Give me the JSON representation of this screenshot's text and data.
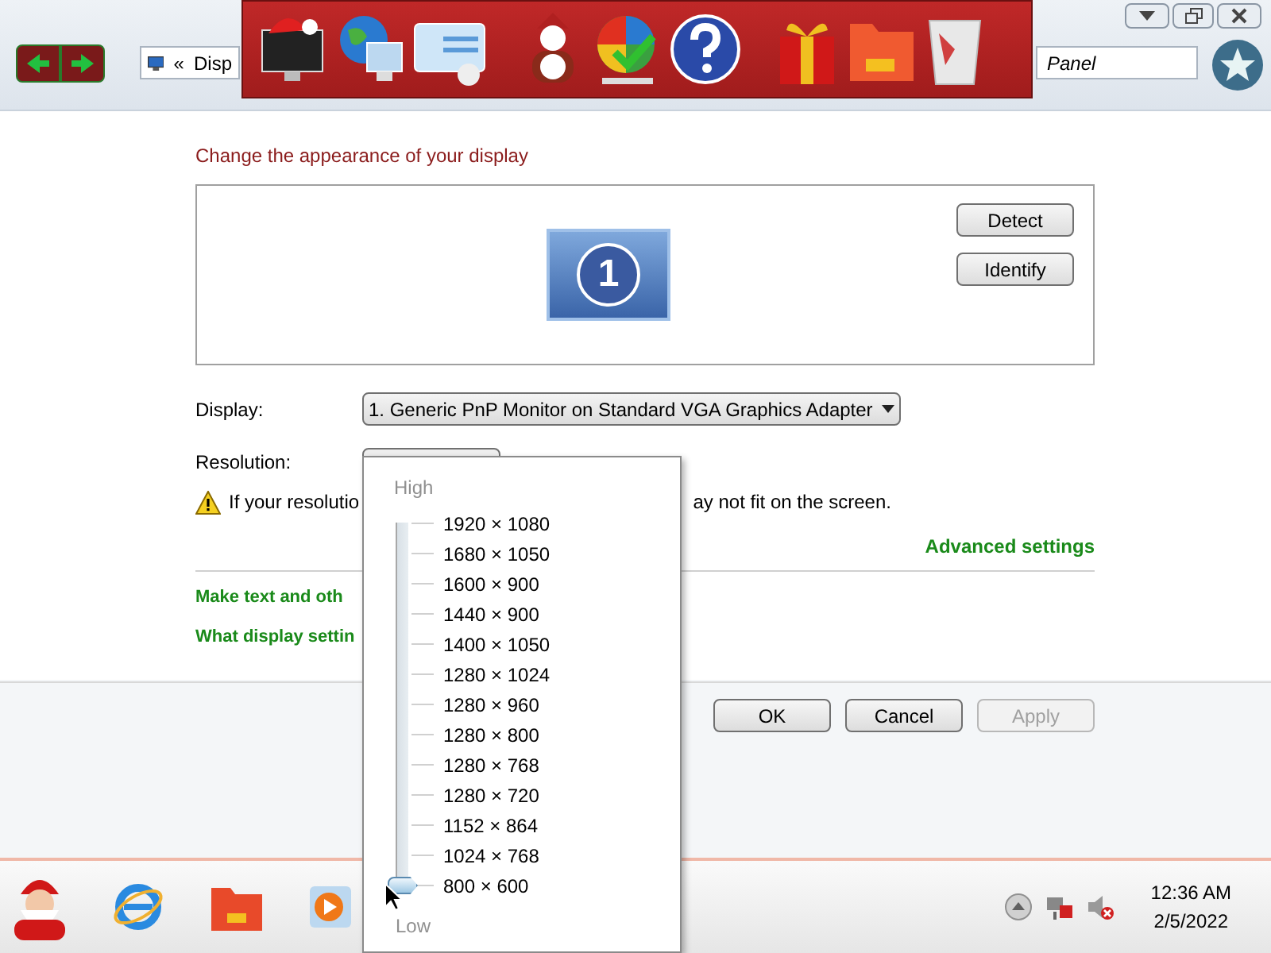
{
  "address_bar": {
    "chevron": "«",
    "path": "Disp"
  },
  "search_box": {
    "value": "Panel"
  },
  "heading": "Change the appearance of your display",
  "monitor_number": "1",
  "side_buttons": [
    "Detect",
    "Identify"
  ],
  "display": {
    "label": "Display:",
    "value": "1. Generic PnP Monitor on Standard VGA Graphics Adapter"
  },
  "resolution": {
    "label": "Resolution:"
  },
  "warning": {
    "start": "If your resolutio",
    "end": "ay not fit on the screen."
  },
  "advanced_link": "Advanced settings",
  "links": [
    "Make text and oth",
    "What display settin"
  ],
  "dialog_buttons": [
    {
      "label": "OK",
      "disabled": false
    },
    {
      "label": "Cancel",
      "disabled": false
    },
    {
      "label": "Apply",
      "disabled": true
    }
  ],
  "resolution_popup": {
    "high_label": "High",
    "low_label": "Low",
    "items": [
      "1920 × 1080",
      "1680 × 1050",
      "1600 × 900",
      "1440 × 900",
      "1400 × 1050",
      "1280 × 1024",
      "1280 × 960",
      "1280 × 800",
      "1280 × 768",
      "1280 × 720",
      "1152 × 864",
      "1024 × 768",
      "800 × 600"
    ],
    "slider": {
      "level": 0
    }
  },
  "clock": {
    "time": "12:36 AM",
    "date": "2/5/2022"
  }
}
